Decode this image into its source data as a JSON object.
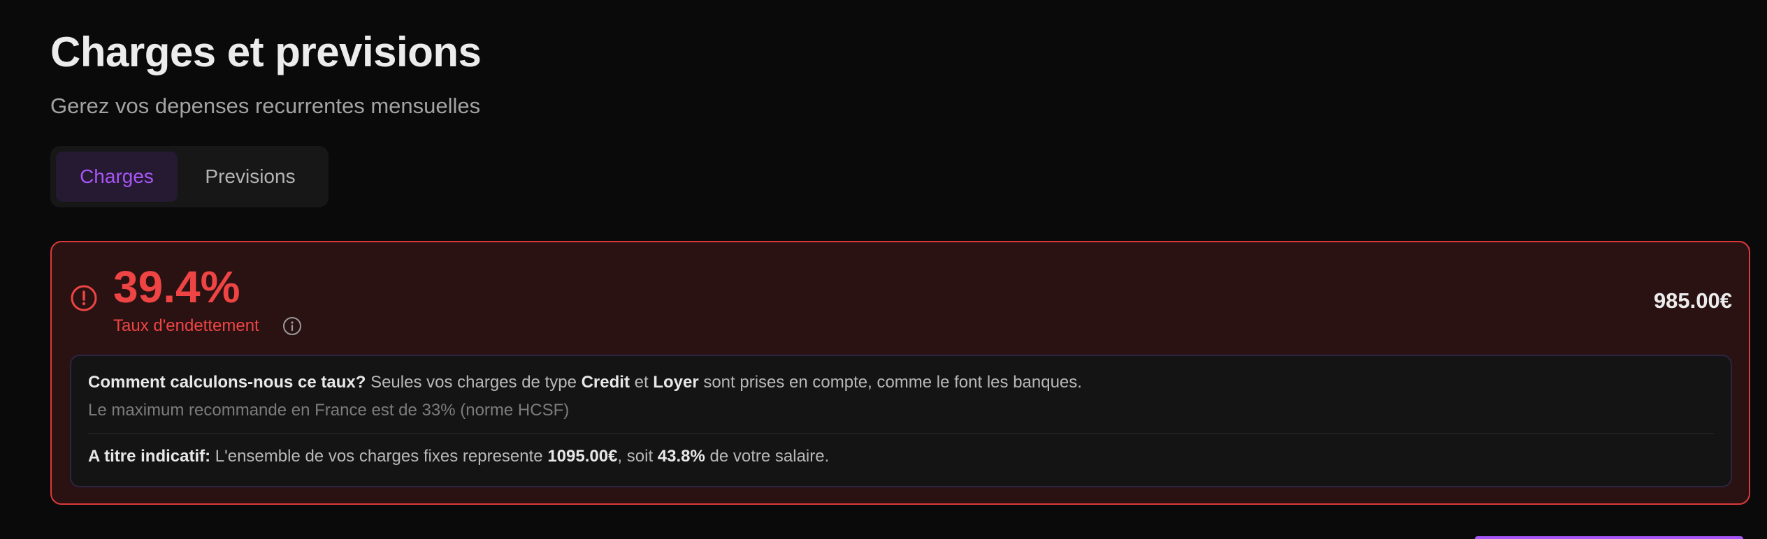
{
  "header": {
    "title": "Charges et previsions",
    "subtitle": "Gerez vos depenses recurrentes mensuelles"
  },
  "tabs": [
    {
      "label": "Charges",
      "active": true
    },
    {
      "label": "Previsions",
      "active": false
    }
  ],
  "alert": {
    "rate": "39.4%",
    "rate_label": "Taux d'endettement",
    "amount": "985.00€",
    "icons": {
      "status": "alert-circle-icon",
      "info": "info-icon"
    },
    "colors": {
      "danger": "#ef4444",
      "card_bg": "#2a1213",
      "accent": "#a855f7"
    },
    "explanation": {
      "q_bold": "Comment calculons-nous ce taux?",
      "q_text1": " Seules vos charges de type ",
      "q_credit": "Credit",
      "q_text2": " et ",
      "q_loyer": "Loyer",
      "q_text3": " sont prises en compte, comme le font les banques.",
      "max_note": "Le maximum recommande en France est de 33% (norme HCSF)",
      "ind_bold": "A titre indicatif:",
      "ind_text1": " L'ensemble de vos charges fixes represente ",
      "ind_total": "1095.00€",
      "ind_text2": ", soit ",
      "ind_pct": "43.8%",
      "ind_text3": " de votre salaire."
    }
  }
}
